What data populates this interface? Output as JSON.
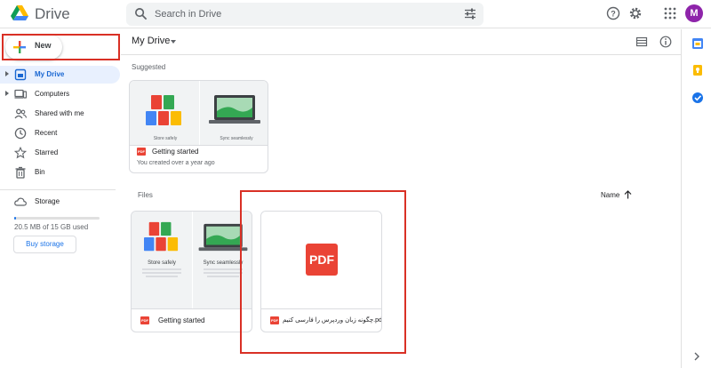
{
  "header": {
    "app_title": "Drive",
    "search_placeholder": "Search in Drive",
    "avatar_letter": "M"
  },
  "sidebar": {
    "new_label": "New",
    "items": [
      {
        "label": "My Drive",
        "icon": "my-drive-icon",
        "active": true
      },
      {
        "label": "Computers",
        "icon": "computer-icon"
      },
      {
        "label": "Shared with me",
        "icon": "shared-icon"
      },
      {
        "label": "Recent",
        "icon": "clock-icon"
      },
      {
        "label": "Starred",
        "icon": "star-icon"
      },
      {
        "label": "Bin",
        "icon": "trash-icon"
      },
      {
        "label": "Storage",
        "icon": "cloud-icon"
      }
    ],
    "storage_text": "20.5 MB of 15 GB used",
    "storage_fraction": 0.0014,
    "buy_storage_label": "Buy storage"
  },
  "main": {
    "title": "My Drive",
    "suggested_label": "Suggested",
    "suggested": {
      "name": "Getting started",
      "subtitle": "You created over a year ago",
      "thumb_left_text": "Store safely",
      "thumb_right_text": "Sync seamlessly"
    },
    "files_label": "Files",
    "sort_label": "Name",
    "files": [
      {
        "name": "Getting started",
        "thumb_left_title": "Store safely",
        "thumb_right_title": "Sync seamlessly"
      },
      {
        "name": "چگونه زبان وردپرس را فارسی کنیم.pdf",
        "preview_badge": "PDF"
      }
    ],
    "pdf_badge": "PDF"
  },
  "colors": {
    "accent": "#1a73e8",
    "active_bg": "#e8f0fe",
    "pdf_red": "#ea4335",
    "highlight": "#d93025",
    "avatar": "#8e24aa"
  }
}
